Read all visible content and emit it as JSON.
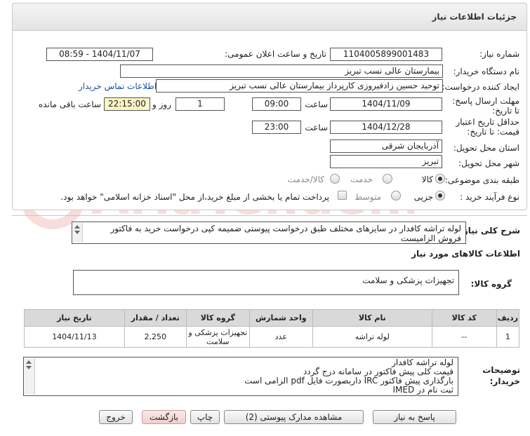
{
  "header": {
    "title": "جزئیات اطلاعات نیاز"
  },
  "fields": {
    "need_number_label": "شماره نیاز:",
    "need_number": "1104005899001483",
    "announce_label": "تاریخ و ساعت اعلان عمومی:",
    "announce_value": "1404/11/07 - 08:59",
    "buyer_org_label": "نام دستگاه خریدار:",
    "buyer_org": "بیمارستان عالی نسب تبریز",
    "creator_label": "ایجاد کننده درخواست:",
    "creator": "توحید حسین زادفیروزی کارپرداز بیمارستان عالی نسب تبریز",
    "contact_link": "اطلاعات تماس خریدار",
    "deadline_label": "مهلت ارسال پاسخ: تا تاریخ:",
    "deadline_date": "1404/11/09",
    "time_label": "ساعت",
    "deadline_time": "09:00",
    "days_value": "1",
    "days_label": "روز و",
    "remaining_time": "22:15:00",
    "remaining_label": "ساعت باقی مانده",
    "validity_label": "حداقل تاریخ اعتبار قیمت: تا تاریخ:",
    "validity_date": "1404/12/28",
    "validity_time": "23:00",
    "province_label": "استان محل تحویل:",
    "province": "آذربایجان شرقی",
    "city_label": "شهر محل تحویل:",
    "city": "تبریز",
    "category_label": "طبقه بندی موضوعی:",
    "category_options": [
      "کالا",
      "خدمت",
      "کالا/خدمت"
    ],
    "process_label": "نوع فرآیند خرید :",
    "process_options": [
      "جزیی",
      "متوسط"
    ],
    "payment_note": "پرداخت تمام یا بخشی از مبلغ خرید،از محل \"اسناد خزانه اسلامی\" خواهد بود."
  },
  "description": {
    "label": "شرح کلی نیاز:",
    "text": "لوله تراشه کافدار در سایزهای مختلف طبق درخواست پیوستی ضمیمه کپی درخواست خرید به فاکتور فروش الزامیست"
  },
  "goods": {
    "section_title": "اطلاعات کالاهای مورد نیاز",
    "group_label": "گروه کالا:",
    "group_value": "تجهیزات پزشکی و سلامت",
    "table": {
      "headers": [
        "ردیف",
        "کد کالا",
        "نام کالا",
        "واحد شمارش",
        "گروه کالا",
        "تعداد / مقدار",
        "تاریخ نیاز"
      ],
      "rows": [
        [
          "1",
          "--",
          "لوله تراشه",
          "عدد",
          "تجهیزات پزشکی و سلامت",
          "2,250",
          "1404/11/13"
        ]
      ]
    }
  },
  "buyer_notes": {
    "label": "توضیحات خریدار:",
    "lines": [
      "لوله تراشه کافدار",
      "قیمت کلی پیش فاکتور در سامانه درج گردد",
      "بارگذاری پیش فاکتور IRC داربصورت فایل pdf الزامی است",
      "ثبت نام در IMED"
    ]
  },
  "buttons": {
    "reply": "پاسخ به نیاز",
    "docs": "مشاهده مدارک پیوستی (2)",
    "print": "چاپ",
    "back": "بازگشت",
    "exit": "خروج"
  },
  "watermark_text": "AriaTender.net",
  "colors": {
    "link": "#1a4fa8",
    "highlight": "#fdf5c5",
    "table_header": "#d9d9d9"
  }
}
